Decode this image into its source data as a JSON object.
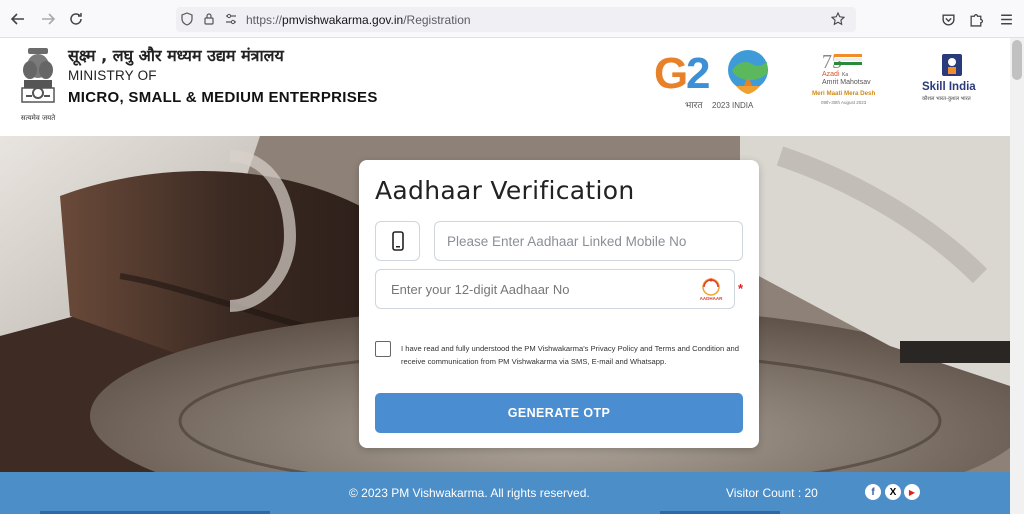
{
  "browser": {
    "url_prefix": "https://",
    "url_domain": "pmvishwakarma.gov.in",
    "url_path": "/Registration"
  },
  "header": {
    "hindi_title": "सूक्ष्म , लघु और मध्यम उद्यम मंत्रालय",
    "ministry_of": "MINISTRY OF",
    "ministry_name": "MICRO, SMALL & MEDIUM ENTERPRISES",
    "emblem_motto": "सत्यमेव जयते",
    "g20_caption": "2023 INDIA",
    "azadi_line1": "Azadi",
    "azadi_line2": "Ka",
    "azadi_line3": "Amrit Mahotsav",
    "azadi_tag": "Meri Maati Mera Desh",
    "azadi_dates": "09th-30th August 2023",
    "skill_india": "Skill India",
    "skill_sub": "कौशल भारत-कुशल भारत"
  },
  "card": {
    "title": "Aadhaar Verification",
    "mobile_placeholder": "Please Enter Aadhaar Linked Mobile No",
    "aadhaar_placeholder": "Enter your 12-digit Aadhaar No",
    "required_marker": "*",
    "consent_text": "I have read and fully understood the PM Vishwakarma's Privacy Policy and Terms and Condition and receive communication from PM Vishwakarma via SMS, E-mail and Whatsapp.",
    "button_label": "GENERATE OTP",
    "aadhaar_logo_text": "AADHAAR"
  },
  "footer": {
    "copyright": "© 2023 PM Vishwakarma. All rights reserved.",
    "visitor_count": "Visitor Count : 20",
    "social": [
      "f",
      "X",
      "▶"
    ]
  },
  "colors": {
    "primary": "#4a8dd0",
    "footer_bg": "#4b8ec8",
    "required": "#e02020"
  }
}
